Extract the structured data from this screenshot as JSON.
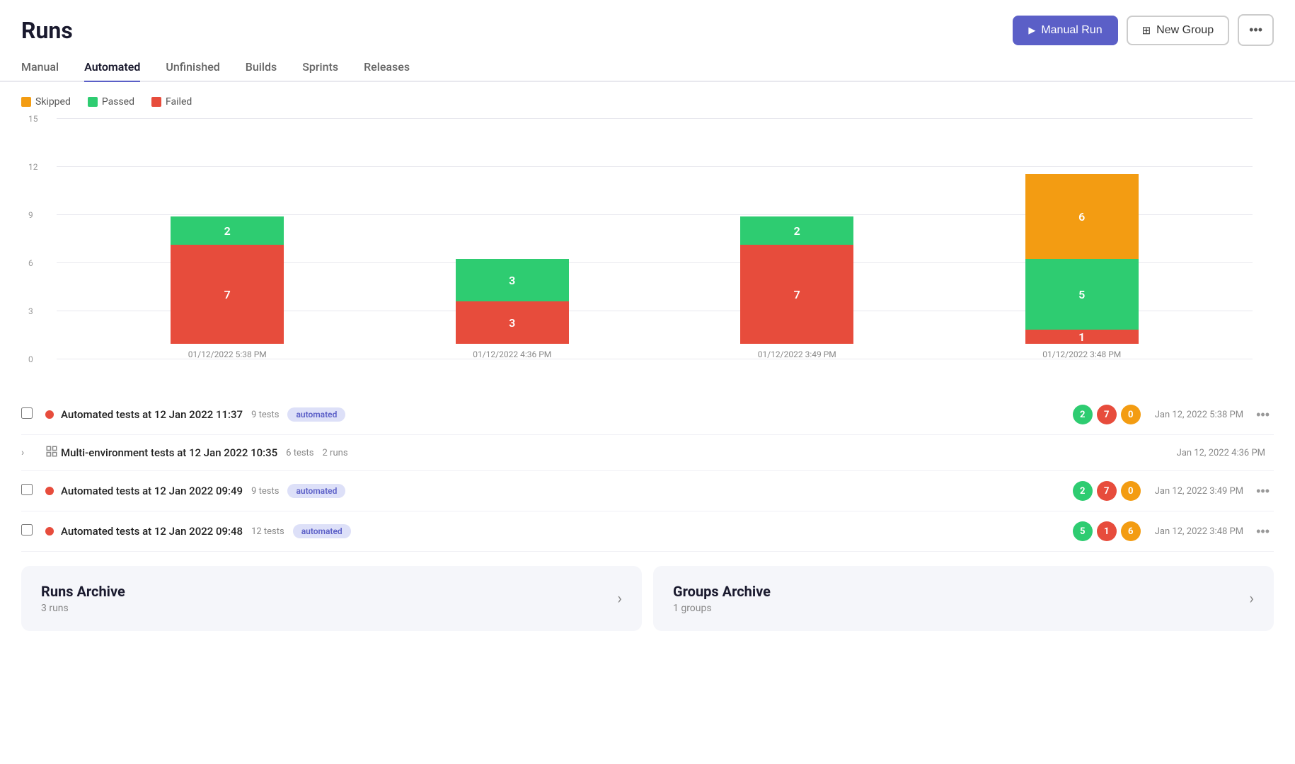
{
  "header": {
    "title": "Runs",
    "buttons": {
      "manual_run": "Manual Run",
      "new_group": "New Group",
      "more": "..."
    }
  },
  "tabs": [
    {
      "label": "Manual",
      "active": false
    },
    {
      "label": "Automated",
      "active": true
    },
    {
      "label": "Unfinished",
      "active": false
    },
    {
      "label": "Builds",
      "active": false
    },
    {
      "label": "Sprints",
      "active": false
    },
    {
      "label": "Releases",
      "active": false
    }
  ],
  "chart": {
    "legend": [
      {
        "label": "Skipped",
        "color": "#f39c12"
      },
      {
        "label": "Passed",
        "color": "#2ecc71"
      },
      {
        "label": "Failed",
        "color": "#e74c3c"
      }
    ],
    "y_labels": [
      "0",
      "3",
      "6",
      "9",
      "12",
      "15"
    ],
    "bars": [
      {
        "date": "01/12/2022 5:38 PM",
        "segments": [
          {
            "value": 2,
            "color": "#2ecc71",
            "label": "2"
          },
          {
            "value": 7,
            "color": "#e74c3c",
            "label": "7"
          }
        ]
      },
      {
        "date": "01/12/2022 4:36 PM",
        "segments": [
          {
            "value": 3,
            "color": "#2ecc71",
            "label": "3"
          },
          {
            "value": 3,
            "color": "#e74c3c",
            "label": "3"
          }
        ]
      },
      {
        "date": "01/12/2022 3:49 PM",
        "segments": [
          {
            "value": 2,
            "color": "#2ecc71",
            "label": "2"
          },
          {
            "value": 7,
            "color": "#e74c3c",
            "label": "7"
          }
        ]
      },
      {
        "date": "01/12/2022 3:48 PM",
        "segments": [
          {
            "value": 6,
            "color": "#f39c12",
            "label": "6"
          },
          {
            "value": 5,
            "color": "#2ecc71",
            "label": "5"
          },
          {
            "value": 1,
            "color": "#e74c3c",
            "label": "1"
          }
        ]
      }
    ]
  },
  "runs": [
    {
      "name": "Automated tests at 12 Jan 2022 11:37",
      "tests": "9 tests",
      "badge": "automated",
      "counts": [
        {
          "value": 2,
          "type": "green"
        },
        {
          "value": 7,
          "type": "red"
        },
        {
          "value": 0,
          "type": "yellow"
        }
      ],
      "date": "Jan 12, 2022 5:38 PM",
      "has_checkbox": true,
      "expandable": false
    },
    {
      "name": "Multi-environment tests at 12 Jan 2022 10:35",
      "tests": "6 tests",
      "runs": "2 runs",
      "badge": null,
      "counts": null,
      "date": "Jan 12, 2022 4:36 PM",
      "has_checkbox": false,
      "expandable": true,
      "is_group": true
    },
    {
      "name": "Automated tests at 12 Jan 2022 09:49",
      "tests": "9 tests",
      "badge": "automated",
      "counts": [
        {
          "value": 2,
          "type": "green"
        },
        {
          "value": 7,
          "type": "red"
        },
        {
          "value": 0,
          "type": "yellow"
        }
      ],
      "date": "Jan 12, 2022 3:49 PM",
      "has_checkbox": true,
      "expandable": false
    },
    {
      "name": "Automated tests at 12 Jan 2022 09:48",
      "tests": "12 tests",
      "badge": "automated",
      "counts": [
        {
          "value": 5,
          "type": "green"
        },
        {
          "value": 1,
          "type": "red"
        },
        {
          "value": 6,
          "type": "yellow"
        }
      ],
      "date": "Jan 12, 2022 3:48 PM",
      "has_checkbox": true,
      "expandable": false
    }
  ],
  "archive": {
    "runs": {
      "title": "Runs Archive",
      "subtitle": "3 runs",
      "chevron": "›"
    },
    "groups": {
      "title": "Groups Archive",
      "subtitle": "1 groups",
      "chevron": "›"
    }
  }
}
